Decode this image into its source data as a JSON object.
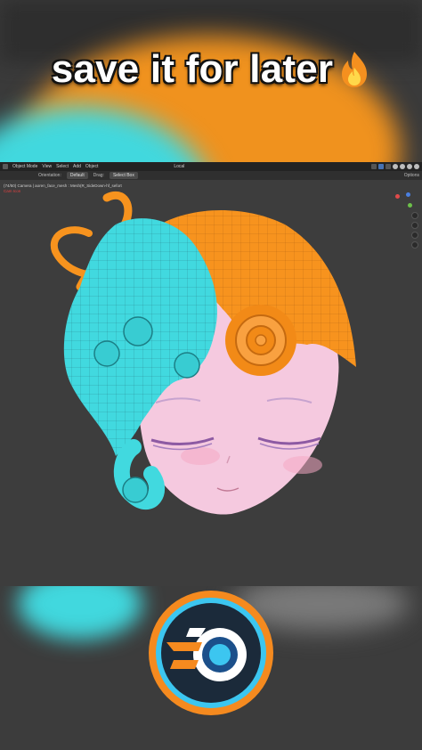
{
  "caption": {
    "text": "save it for later",
    "emoji_icon": "fire-icon"
  },
  "blender": {
    "header": {
      "mode": "Object Mode",
      "menus": [
        "View",
        "Select",
        "Add",
        "Object"
      ],
      "orientation": "Local"
    },
    "toolbar": {
      "orientation_label": "Orientation:",
      "orientation_value": "Default",
      "drag_label": "Drag:",
      "drag_value": "Select Box",
      "options_label": "Options"
    },
    "viewport": {
      "camera_line": "(74/50) Camera | aoren_face_mesh : Mesh(R_SideDown-hf_sefort",
      "overlay_note": "Cam Icon"
    },
    "model_colors": {
      "hair_orange": "#f7931e",
      "hair_cyan": "#41d9df",
      "skin": "#f3c8e0",
      "eyelash": "#8d5aa3"
    }
  },
  "logo": {
    "name": "blender-logo",
    "ring_color": "#f58a1f",
    "inner_color": "#3cc6f0"
  }
}
